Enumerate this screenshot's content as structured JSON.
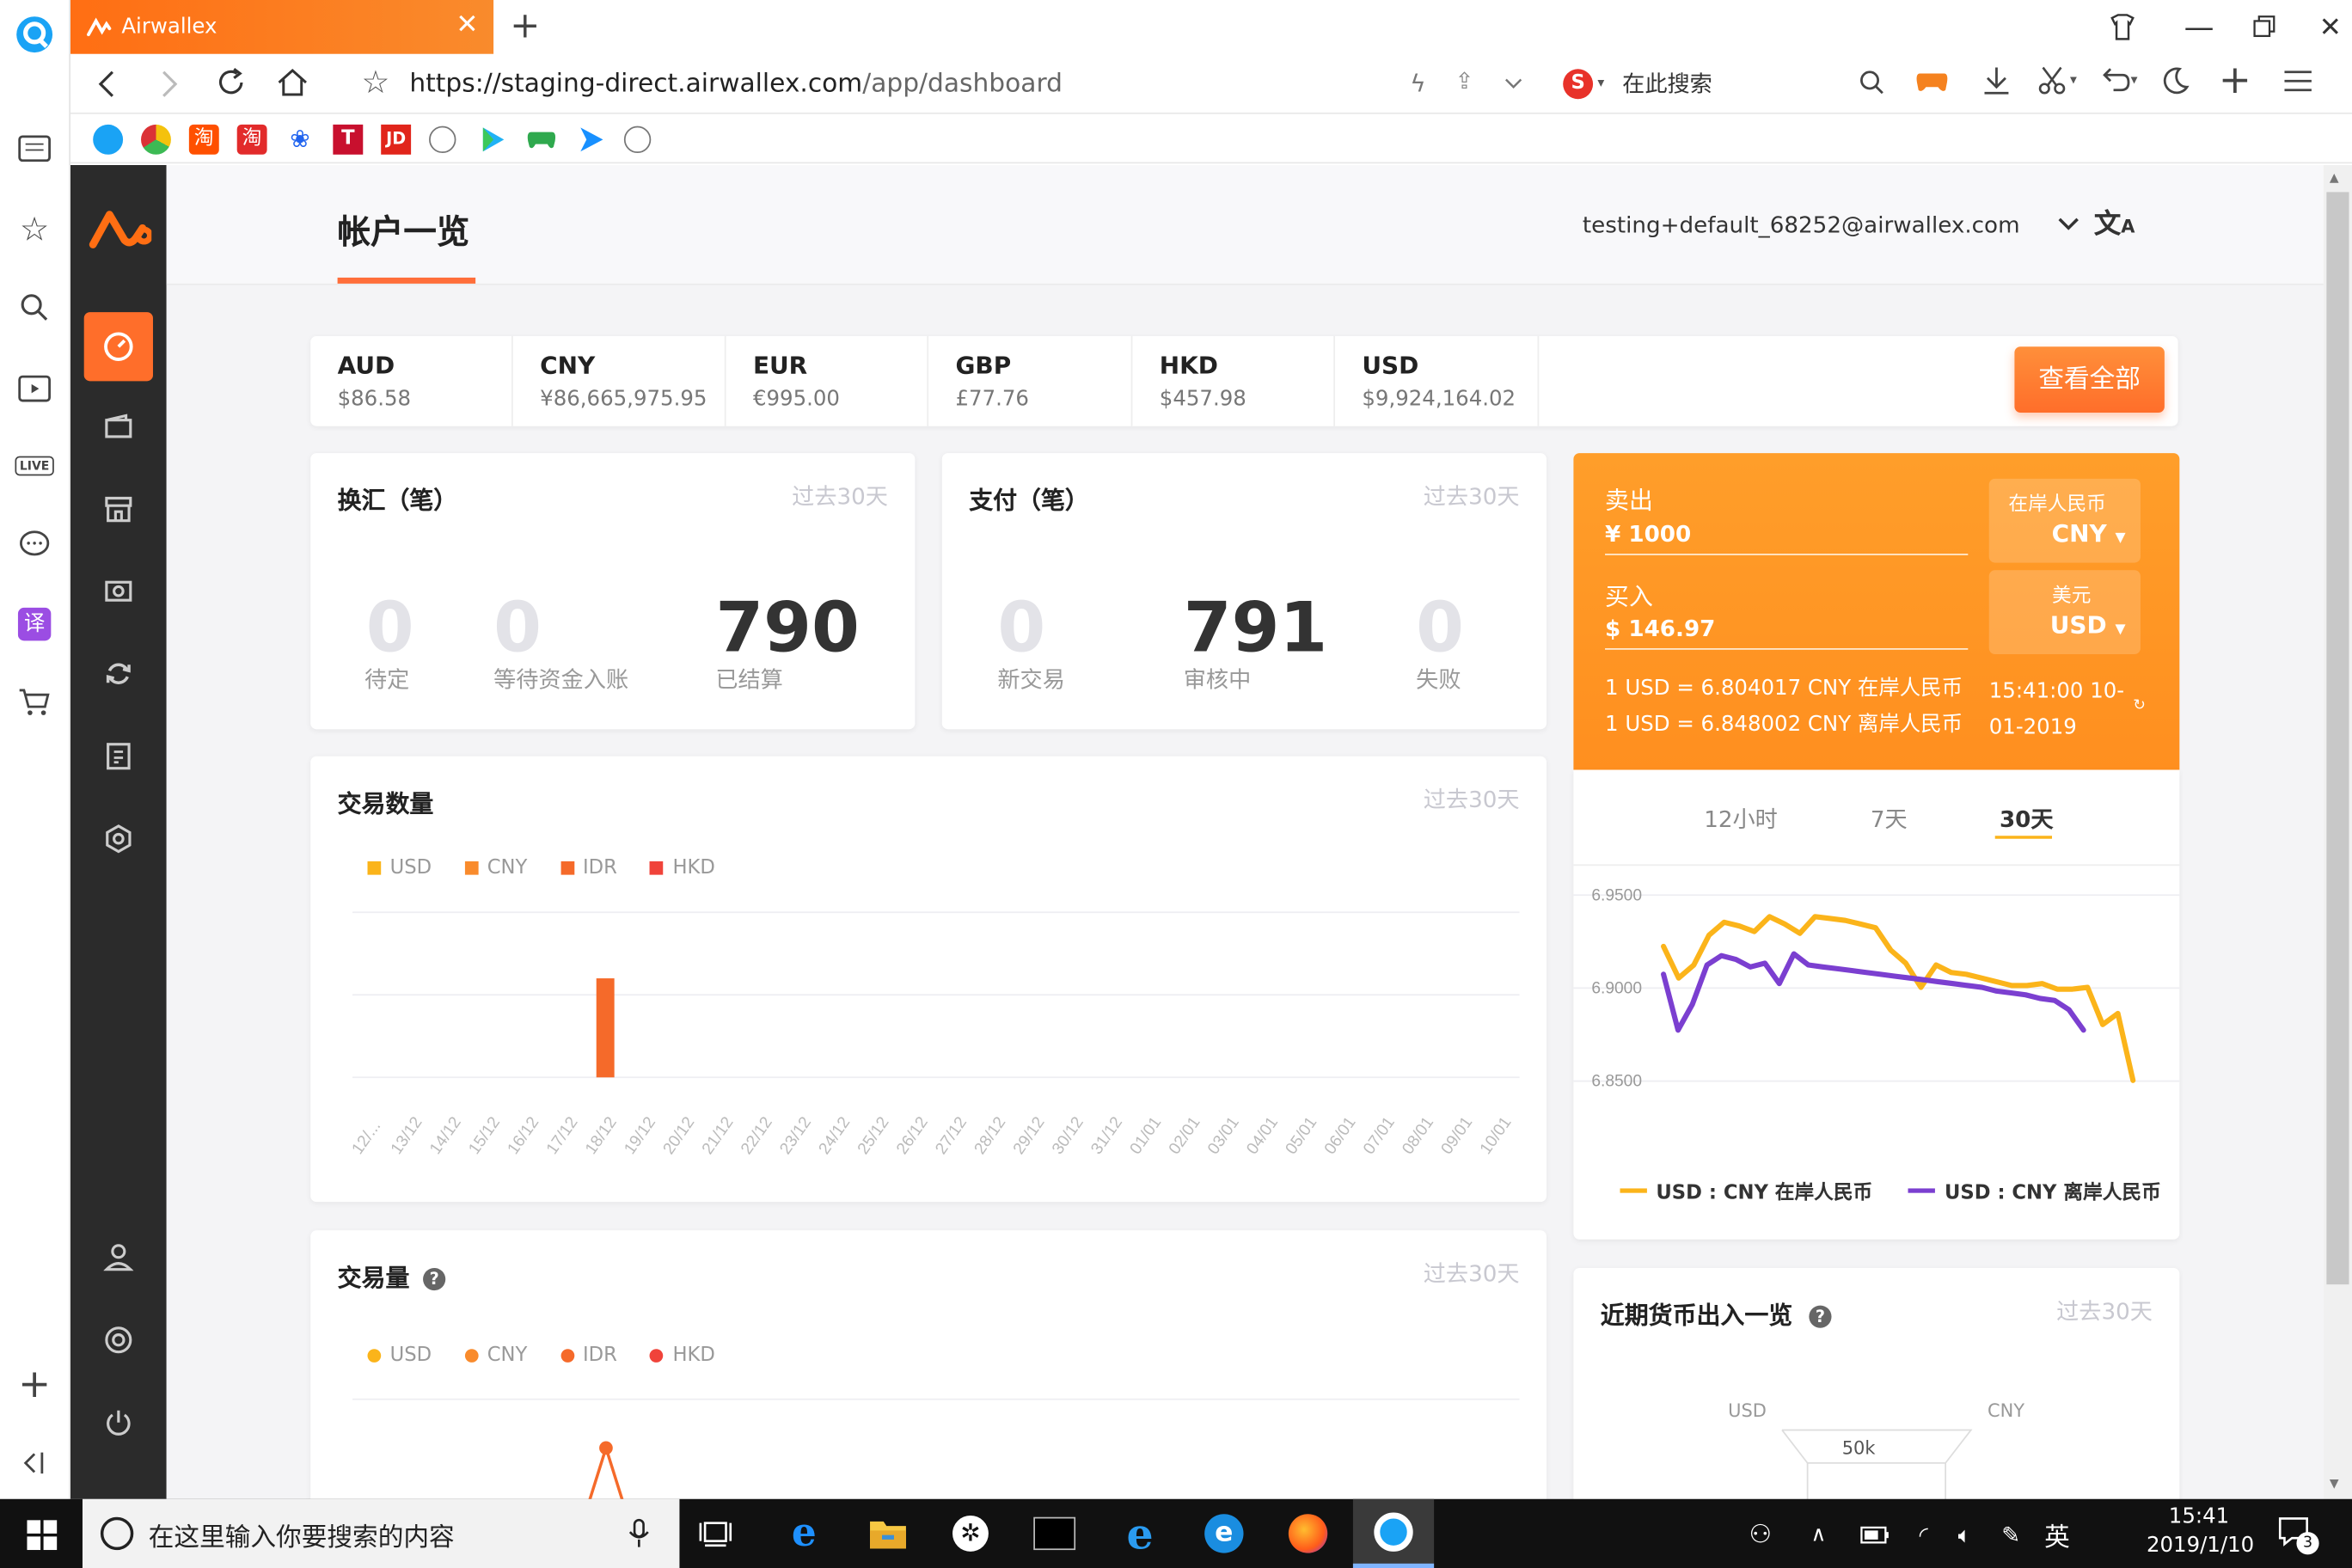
{
  "browser": {
    "tab_title": "Airwallex",
    "url_host": "https://staging-direct.airwallex.com",
    "url_path": "/app/dashboard",
    "search_placeholder": "在此搜索",
    "bookmarks": [
      "qq",
      "color",
      "淘",
      "淘",
      "paw",
      "T",
      "JD",
      "globe",
      "play",
      "game",
      "arrow",
      "globe"
    ]
  },
  "app": {
    "page_title": "帐户一览",
    "user_email": "testing+default_68252@airwallex.com",
    "nav_items": [
      "dashboard-icon",
      "wallet-icon",
      "store-icon",
      "camera-icon",
      "exchange-icon",
      "ledger-icon",
      "settings-icon",
      "user-icon",
      "support-icon",
      "power-icon"
    ]
  },
  "balances": {
    "items": [
      {
        "code": "AUD",
        "amount": "$86.58"
      },
      {
        "code": "CNY",
        "amount": "¥86,665,975.95"
      },
      {
        "code": "EUR",
        "amount": "€995.00"
      },
      {
        "code": "GBP",
        "amount": "£77.76"
      },
      {
        "code": "HKD",
        "amount": "$457.98"
      },
      {
        "code": "USD",
        "amount": "$9,924,164.02"
      }
    ],
    "view_all": "查看全部"
  },
  "fx_card": {
    "title": "换汇（笔）",
    "period": "过去30天",
    "stats": [
      {
        "value": "0",
        "label": "待定"
      },
      {
        "value": "0",
        "label": "等待资金入账"
      },
      {
        "value": "790",
        "label": "已结算"
      }
    ]
  },
  "pay_card": {
    "title": "支付（笔）",
    "period": "过去30天",
    "stats": [
      {
        "value": "0",
        "label": "新交易"
      },
      {
        "value": "791",
        "label": "审核中"
      },
      {
        "value": "0",
        "label": "失败"
      }
    ]
  },
  "txn_count": {
    "title": "交易数量",
    "period": "过去30天",
    "legend": [
      "USD",
      "CNY",
      "IDR",
      "HKD"
    ]
  },
  "txn_volume": {
    "title": "交易量",
    "period": "过去30天",
    "legend": [
      "USD",
      "CNY",
      "IDR",
      "HKD"
    ]
  },
  "converter": {
    "sell_label": "卖出",
    "sell_value": "¥ 1000",
    "buy_label": "买入",
    "buy_value": "$ 146.97",
    "sell_ccy_name": "在岸人民币",
    "sell_ccy": "CNY",
    "buy_ccy_name": "美元",
    "buy_ccy": "USD",
    "rate1": "1 USD = 6.804017 CNY 在岸人民币",
    "rate2": "1 USD = 6.848002 CNY 离岸人民币",
    "time1": "15:41:00 10-",
    "time2": "01-2019",
    "tabs": [
      "12小时",
      "7天",
      "30天"
    ],
    "legend1": "USD : CNY 在岸人民币",
    "legend2": "USD : CNY 离岸人民币"
  },
  "recent_flow": {
    "title": "近期货币出入一览",
    "period": "过去30天",
    "left_label": "USD",
    "right_label": "CNY",
    "center_label": "50k"
  },
  "taskbar": {
    "search_placeholder": "在这里输入你要搜索的内容",
    "ime": "英",
    "time": "15:41",
    "date": "2019/1/10",
    "notif_count": "3"
  },
  "colors": {
    "brand": "#ff6e13",
    "usd": "#fbb41a",
    "cny": "#f98b2c",
    "idr": "#f56a2a",
    "hkd": "#f0433a",
    "offshore": "#7b3fd0"
  },
  "chart_data": [
    {
      "type": "bar",
      "title": "交易数量",
      "categories": [
        "12/...",
        "13/12",
        "14/12",
        "15/12",
        "16/12",
        "17/12",
        "18/12",
        "19/12",
        "20/12",
        "21/12",
        "22/12",
        "23/12",
        "24/12",
        "25/12",
        "26/12",
        "27/12",
        "28/12",
        "29/12",
        "30/12",
        "31/12",
        "01/01",
        "02/01",
        "03/01",
        "04/01",
        "05/01",
        "06/01",
        "07/01",
        "08/01",
        "09/01",
        "10/01"
      ],
      "series": [
        {
          "name": "USD",
          "values": [
            0,
            0,
            0,
            0,
            0,
            0,
            0,
            0,
            0,
            0,
            0,
            0,
            0,
            0,
            0,
            0,
            0,
            0,
            0,
            0,
            0,
            0,
            0,
            0,
            0,
            0,
            0,
            0,
            0,
            0
          ]
        },
        {
          "name": "CNY",
          "values": [
            0,
            0,
            0,
            0,
            0,
            0,
            0,
            0,
            0,
            0,
            0,
            0,
            0,
            0,
            0,
            0,
            0,
            0,
            0,
            0,
            0,
            0,
            0,
            0,
            0,
            0,
            0,
            0,
            0,
            0
          ]
        },
        {
          "name": "IDR",
          "values": [
            0,
            0,
            0,
            0,
            0,
            0,
            1,
            0,
            0,
            0,
            0,
            0,
            0,
            0,
            0,
            0,
            0,
            0,
            0,
            0,
            0,
            0,
            0,
            0,
            0,
            0,
            0,
            0,
            0,
            0
          ]
        },
        {
          "name": "HKD",
          "values": [
            0,
            0,
            0,
            0,
            0,
            0,
            0,
            0,
            0,
            0,
            0,
            0,
            0,
            0,
            0,
            0,
            0,
            0,
            0,
            0,
            0,
            0,
            0,
            0,
            0,
            0,
            0,
            0,
            0,
            0
          ]
        }
      ],
      "ylim": [
        0,
        1.3
      ]
    },
    {
      "type": "line",
      "title": "",
      "y_ticks": [
        "6.9500",
        "6.9000",
        "6.8500"
      ],
      "ylim": [
        6.83,
        6.96
      ],
      "series": [
        {
          "name": "USD : CNY 在岸人民币",
          "values": [
            6.922,
            6.905,
            6.912,
            6.928,
            6.935,
            6.933,
            6.93,
            6.938,
            6.934,
            6.929,
            6.938,
            6.937,
            6.936,
            6.934,
            6.932,
            6.92,
            6.913,
            6.9,
            6.912,
            6.908,
            6.907,
            6.905,
            6.903,
            6.901,
            6.901,
            6.902,
            6.899,
            6.899,
            6.9,
            6.88,
            6.886,
            6.85
          ]
        },
        {
          "name": "USD : CNY 离岸人民币",
          "values": [
            6.907,
            6.877,
            6.891,
            6.912,
            6.917,
            6.915,
            6.911,
            6.913,
            6.902,
            6.918,
            6.912,
            6.911,
            6.91,
            6.909,
            6.908,
            6.907,
            6.906,
            6.905,
            6.904,
            6.903,
            6.902,
            6.901,
            6.9,
            6.898,
            6.897,
            6.896,
            6.894,
            6.893,
            6.888,
            6.877
          ]
        }
      ]
    }
  ]
}
